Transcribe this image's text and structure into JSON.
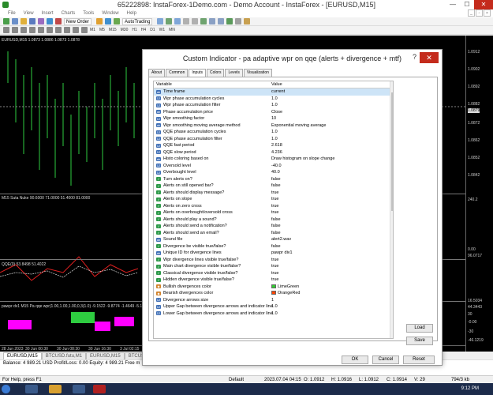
{
  "window": {
    "title": "65222898: InstaForex-1Demo.com - Demo Account - InstaForex - [EURUSD,M15]"
  },
  "menu": [
    "File",
    "View",
    "Insert",
    "Charts",
    "Tools",
    "Window",
    "Help"
  ],
  "toolbar": {
    "new_order": "New Order",
    "autotrading": "AutoTrading",
    "timeframes": [
      "M1",
      "M5",
      "M15",
      "M30",
      "H1",
      "H4",
      "D1",
      "W1",
      "MN"
    ]
  },
  "chart": {
    "main_label": "EURUSD,M15 1.0873 1.0886 1.0873 1.0878",
    "suta_label": "M15 Suta Nuke  90.6000 71.0000 51.4000 81.0000",
    "qqe_label": "QQE(0) 53.8498 51.4022",
    "wpr_label": "pawpr dv1 M15  Pa qqe wpr(1.00,1.00,1.00,0,3(1.0) -9.1522 -9.8774 -1.4649 -5.1423",
    "price_ticks": [
      "1.0912",
      "1.0902",
      "1.0892",
      "1.0882",
      "1.0879",
      "1.0872",
      "1.0862",
      "1.0852",
      "1.0842"
    ],
    "suta_ticks": [
      "240.2"
    ],
    "qqe_ticks": [
      "0.00",
      "96.0717"
    ],
    "wpr_ticks": [
      "16.5034",
      "44.3443",
      "30",
      "-0.00",
      "-30",
      "-46.1219"
    ],
    "time_labels": [
      "28 Jun 2023",
      "30 Jun 00:30",
      "30 Jun 08:30",
      "30 Jun 16:30",
      "3 Jul 02:15"
    ]
  },
  "dialog": {
    "title": "Custom Indicator - pa adaptive wpr on qqe (alerts + divergence + mtf)",
    "help": "?",
    "tabs": [
      "About",
      "Common",
      "Inputs",
      "Colors",
      "Levels",
      "Visualization"
    ],
    "active_tab": "Inputs",
    "col_variable": "Variable",
    "col_value": "Value",
    "rows": [
      {
        "type": "str",
        "name": "Time frame",
        "value": "current"
      },
      {
        "type": "num",
        "name": "Wpr phase accumulation cycles",
        "value": "1.0"
      },
      {
        "type": "num",
        "name": "Wpr phase accumulation filter",
        "value": "1.0"
      },
      {
        "type": "str",
        "name": "Phase accumulation price",
        "value": "Close"
      },
      {
        "type": "num",
        "name": "Wpr smoothing factor",
        "value": "10"
      },
      {
        "type": "str",
        "name": "Wpr smoothing moving average method",
        "value": "Exponential moving average"
      },
      {
        "type": "num",
        "name": "QQE phase accumulation cycles",
        "value": "1.0"
      },
      {
        "type": "num",
        "name": "QQE phase accumulation filter",
        "value": "1.0"
      },
      {
        "type": "num",
        "name": "QQE fast period",
        "value": "2.618"
      },
      {
        "type": "num",
        "name": "QQE slow period",
        "value": "4.236"
      },
      {
        "type": "str",
        "name": "Histo coloring based on",
        "value": "Draw histogram on slope change"
      },
      {
        "type": "num",
        "name": "Oversold level",
        "value": "-40.0"
      },
      {
        "type": "num",
        "name": "Overbought level",
        "value": "40.0"
      },
      {
        "type": "bool",
        "name": "Turn alerts on?",
        "value": "false"
      },
      {
        "type": "bool",
        "name": "Alerts on still opened bar?",
        "value": "false"
      },
      {
        "type": "bool",
        "name": "Alerts should display message?",
        "value": "true"
      },
      {
        "type": "bool",
        "name": "Alerts on slope",
        "value": "true"
      },
      {
        "type": "bool",
        "name": "Alerts on zero cross",
        "value": "true"
      },
      {
        "type": "bool",
        "name": "Alerts on overbought/oversold cross",
        "value": "true"
      },
      {
        "type": "bool",
        "name": "Alerts should play a sound?",
        "value": "false"
      },
      {
        "type": "bool",
        "name": "Alerts should send a notification?",
        "value": "false"
      },
      {
        "type": "bool",
        "name": "Alerts should send an email?",
        "value": "false"
      },
      {
        "type": "str",
        "name": "Sound file",
        "value": "alert2.wav"
      },
      {
        "type": "bool",
        "name": "Divergence be visible true/false?",
        "value": "false"
      },
      {
        "type": "str",
        "name": "Unique ID for divergence lines",
        "value": "pawpr div1"
      },
      {
        "type": "bool",
        "name": "Wpr divergence lines visible true/false?",
        "value": "true"
      },
      {
        "type": "bool",
        "name": "Main chart divergence visible true/false?",
        "value": "true"
      },
      {
        "type": "bool",
        "name": "Classical divergence visible true/false?",
        "value": "true"
      },
      {
        "type": "bool",
        "name": "Hidden divergence visible true/false?",
        "value": "true"
      },
      {
        "type": "clr",
        "name": "Bullish divergences color",
        "value": "LimeGreen",
        "swatch": "#32cd32"
      },
      {
        "type": "clr",
        "name": "Bearish divergences color",
        "value": "OrangeRed",
        "swatch": "#ff4500"
      },
      {
        "type": "num",
        "name": "Divergence arrows size",
        "value": "1"
      },
      {
        "type": "num",
        "name": "Upper Gap between divergence arrows and indicator line",
        "value": "1.0"
      },
      {
        "type": "num",
        "name": "Lower Gap between divergence arrows and indicator line",
        "value": "1.0"
      }
    ],
    "load": "Load",
    "save": "Save",
    "ok": "OK",
    "cancel": "Cancel",
    "reset": "Reset"
  },
  "chart_tabs": [
    "EURUSD,M15",
    "BTCUSD.futu,M1",
    "EURUSD,M15",
    "BTCUSD.futu,M1"
  ],
  "balance": "Balance: 4 989.21 USD  Profit/Loss: 0.00  Equity: 4 989.21  Free m",
  "status": {
    "help": "For Help, press F1",
    "profile": "Default",
    "datetime": "2023.07.04 04:15",
    "open": "O: 1.0912",
    "high": "H: 1.0916",
    "low": "L: 1.0912",
    "close": "C: 1.0914",
    "volume": "V: 29",
    "traffic": "794/3 kb"
  },
  "taskbar": {
    "time": "9:12 PM"
  }
}
